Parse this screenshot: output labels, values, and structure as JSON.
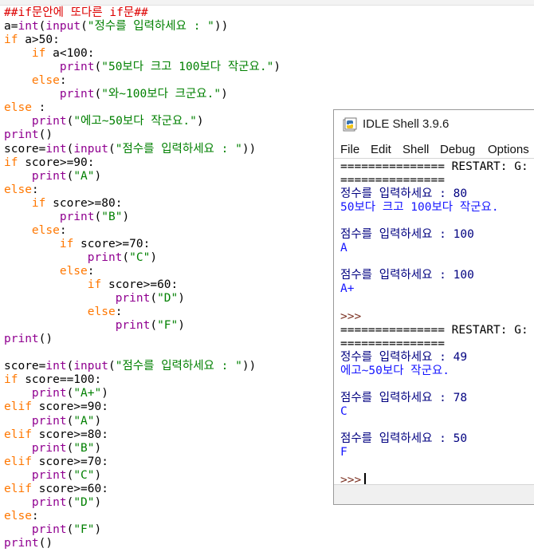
{
  "editor": {
    "lines": [
      {
        "segments": [
          {
            "t": "##if문안에 또다른 if문##",
            "c": "cm"
          }
        ]
      },
      {
        "segments": [
          {
            "t": "a="
          },
          {
            "t": "int",
            "c": "bi"
          },
          {
            "t": "("
          },
          {
            "t": "input",
            "c": "bi"
          },
          {
            "t": "("
          },
          {
            "t": "\"정수를 입력하세요 : \"",
            "c": "str"
          },
          {
            "t": "))"
          }
        ]
      },
      {
        "segments": [
          {
            "t": "if",
            "c": "kw"
          },
          {
            "t": " a>50:"
          }
        ]
      },
      {
        "segments": [
          {
            "t": "    "
          },
          {
            "t": "if",
            "c": "kw"
          },
          {
            "t": " a<100:"
          }
        ]
      },
      {
        "segments": [
          {
            "t": "        "
          },
          {
            "t": "print",
            "c": "bi"
          },
          {
            "t": "("
          },
          {
            "t": "\"50보다 크고 100보다 작군요.\"",
            "c": "str"
          },
          {
            "t": ")"
          }
        ]
      },
      {
        "segments": [
          {
            "t": "    "
          },
          {
            "t": "else",
            "c": "kw"
          },
          {
            "t": ":"
          }
        ]
      },
      {
        "segments": [
          {
            "t": "        "
          },
          {
            "t": "print",
            "c": "bi"
          },
          {
            "t": "("
          },
          {
            "t": "\"와~100보다 크군요.\"",
            "c": "str"
          },
          {
            "t": ")"
          }
        ]
      },
      {
        "segments": [
          {
            "t": "else",
            "c": "kw"
          },
          {
            "t": " :"
          }
        ]
      },
      {
        "segments": [
          {
            "t": "    "
          },
          {
            "t": "print",
            "c": "bi"
          },
          {
            "t": "("
          },
          {
            "t": "\"에고~50보다 작군요.\"",
            "c": "str"
          },
          {
            "t": ")"
          }
        ]
      },
      {
        "segments": [
          {
            "t": "print",
            "c": "bi"
          },
          {
            "t": "()"
          }
        ]
      },
      {
        "segments": [
          {
            "t": "score="
          },
          {
            "t": "int",
            "c": "bi"
          },
          {
            "t": "("
          },
          {
            "t": "input",
            "c": "bi"
          },
          {
            "t": "("
          },
          {
            "t": "\"점수를 입력하세요 : \"",
            "c": "str"
          },
          {
            "t": "))"
          }
        ]
      },
      {
        "segments": [
          {
            "t": "if",
            "c": "kw"
          },
          {
            "t": " score>=90:"
          }
        ]
      },
      {
        "segments": [
          {
            "t": "    "
          },
          {
            "t": "print",
            "c": "bi"
          },
          {
            "t": "("
          },
          {
            "t": "\"A\"",
            "c": "str"
          },
          {
            "t": ")"
          }
        ]
      },
      {
        "segments": [
          {
            "t": "else",
            "c": "kw"
          },
          {
            "t": ":"
          }
        ]
      },
      {
        "segments": [
          {
            "t": "    "
          },
          {
            "t": "if",
            "c": "kw"
          },
          {
            "t": " score>=80:"
          }
        ]
      },
      {
        "segments": [
          {
            "t": "        "
          },
          {
            "t": "print",
            "c": "bi"
          },
          {
            "t": "("
          },
          {
            "t": "\"B\"",
            "c": "str"
          },
          {
            "t": ")"
          }
        ]
      },
      {
        "segments": [
          {
            "t": "    "
          },
          {
            "t": "else",
            "c": "kw"
          },
          {
            "t": ":"
          }
        ]
      },
      {
        "segments": [
          {
            "t": "        "
          },
          {
            "t": "if",
            "c": "kw"
          },
          {
            "t": " score>=70:"
          }
        ]
      },
      {
        "segments": [
          {
            "t": "            "
          },
          {
            "t": "print",
            "c": "bi"
          },
          {
            "t": "("
          },
          {
            "t": "\"C\"",
            "c": "str"
          },
          {
            "t": ")"
          }
        ]
      },
      {
        "segments": [
          {
            "t": "        "
          },
          {
            "t": "else",
            "c": "kw"
          },
          {
            "t": ":"
          }
        ]
      },
      {
        "segments": [
          {
            "t": "            "
          },
          {
            "t": "if",
            "c": "kw"
          },
          {
            "t": " score>=60:"
          }
        ]
      },
      {
        "segments": [
          {
            "t": "                "
          },
          {
            "t": "print",
            "c": "bi"
          },
          {
            "t": "("
          },
          {
            "t": "\"D\"",
            "c": "str"
          },
          {
            "t": ")"
          }
        ]
      },
      {
        "segments": [
          {
            "t": "            "
          },
          {
            "t": "else",
            "c": "kw"
          },
          {
            "t": ":"
          }
        ]
      },
      {
        "segments": [
          {
            "t": "                "
          },
          {
            "t": "print",
            "c": "bi"
          },
          {
            "t": "("
          },
          {
            "t": "\"F\"",
            "c": "str"
          },
          {
            "t": ")"
          }
        ]
      },
      {
        "segments": [
          {
            "t": "print",
            "c": "bi"
          },
          {
            "t": "()"
          }
        ]
      },
      {
        "segments": []
      },
      {
        "segments": [
          {
            "t": "score="
          },
          {
            "t": "int",
            "c": "bi"
          },
          {
            "t": "("
          },
          {
            "t": "input",
            "c": "bi"
          },
          {
            "t": "("
          },
          {
            "t": "\"점수를 입력하세요 : \"",
            "c": "str"
          },
          {
            "t": "))"
          }
        ]
      },
      {
        "segments": [
          {
            "t": "if",
            "c": "kw"
          },
          {
            "t": " score==100:"
          }
        ]
      },
      {
        "segments": [
          {
            "t": "    "
          },
          {
            "t": "print",
            "c": "bi"
          },
          {
            "t": "("
          },
          {
            "t": "\"A+\"",
            "c": "str"
          },
          {
            "t": ")"
          }
        ]
      },
      {
        "segments": [
          {
            "t": "elif",
            "c": "kw"
          },
          {
            "t": " score>=90:"
          }
        ]
      },
      {
        "segments": [
          {
            "t": "    "
          },
          {
            "t": "print",
            "c": "bi"
          },
          {
            "t": "("
          },
          {
            "t": "\"A\"",
            "c": "str"
          },
          {
            "t": ")"
          }
        ]
      },
      {
        "segments": [
          {
            "t": "elif",
            "c": "kw"
          },
          {
            "t": " score>=80:"
          }
        ]
      },
      {
        "segments": [
          {
            "t": "    "
          },
          {
            "t": "print",
            "c": "bi"
          },
          {
            "t": "("
          },
          {
            "t": "\"B\"",
            "c": "str"
          },
          {
            "t": ")"
          }
        ]
      },
      {
        "segments": [
          {
            "t": "elif",
            "c": "kw"
          },
          {
            "t": " score>=70:"
          }
        ]
      },
      {
        "segments": [
          {
            "t": "    "
          },
          {
            "t": "print",
            "c": "bi"
          },
          {
            "t": "("
          },
          {
            "t": "\"C\"",
            "c": "str"
          },
          {
            "t": ")"
          }
        ]
      },
      {
        "segments": [
          {
            "t": "elif",
            "c": "kw"
          },
          {
            "t": " score>=60:"
          }
        ]
      },
      {
        "segments": [
          {
            "t": "    "
          },
          {
            "t": "print",
            "c": "bi"
          },
          {
            "t": "("
          },
          {
            "t": "\"D\"",
            "c": "str"
          },
          {
            "t": ")"
          }
        ]
      },
      {
        "segments": [
          {
            "t": "else",
            "c": "kw"
          },
          {
            "t": ":"
          }
        ]
      },
      {
        "segments": [
          {
            "t": "    "
          },
          {
            "t": "print",
            "c": "bi"
          },
          {
            "t": "("
          },
          {
            "t": "\"F\"",
            "c": "str"
          },
          {
            "t": ")"
          }
        ]
      },
      {
        "segments": [
          {
            "t": "print",
            "c": "bi"
          },
          {
            "t": "()"
          }
        ]
      }
    ]
  },
  "shell": {
    "title": "IDLE Shell 3.9.6",
    "icon": "python-idle-icon",
    "menu": [
      "File",
      "Edit",
      "Shell",
      "Debug",
      "Options"
    ],
    "lines": [
      {
        "text": "=============== RESTART: G:",
        "kind": "sys"
      },
      {
        "text": "===============",
        "kind": "sys"
      },
      {
        "text": "정수를 입력하세요 : 80",
        "kind": "in"
      },
      {
        "text": "50보다 크고 100보다 작군요.",
        "kind": "res"
      },
      {
        "text": "",
        "kind": "sys"
      },
      {
        "text": "점수를 입력하세요 : 100",
        "kind": "in"
      },
      {
        "text": "A",
        "kind": "res"
      },
      {
        "text": "",
        "kind": "sys"
      },
      {
        "text": "점수를 입력하세요 : 100",
        "kind": "in"
      },
      {
        "text": "A+",
        "kind": "res"
      },
      {
        "text": "",
        "kind": "sys"
      },
      {
        "text": ">>>",
        "kind": "prompt"
      },
      {
        "text": "=============== RESTART: G:",
        "kind": "sys"
      },
      {
        "text": "===============",
        "kind": "sys"
      },
      {
        "text": "정수를 입력하세요 : 49",
        "kind": "in"
      },
      {
        "text": "에고~50보다 작군요.",
        "kind": "res"
      },
      {
        "text": "",
        "kind": "sys"
      },
      {
        "text": "점수를 입력하세요 : 78",
        "kind": "in"
      },
      {
        "text": "C",
        "kind": "res"
      },
      {
        "text": "",
        "kind": "sys"
      },
      {
        "text": "점수를 입력하세요 : 50",
        "kind": "in"
      },
      {
        "text": "F",
        "kind": "res"
      },
      {
        "text": "",
        "kind": "sys"
      },
      {
        "text": ">>>",
        "kind": "prompt",
        "cursor": true
      }
    ]
  },
  "colors": {
    "keyword": "#ff7700",
    "builtin": "#900090",
    "string": "#008000",
    "comment": "#dd0000",
    "shell_input": "#000080",
    "shell_output": "#1515ff"
  }
}
